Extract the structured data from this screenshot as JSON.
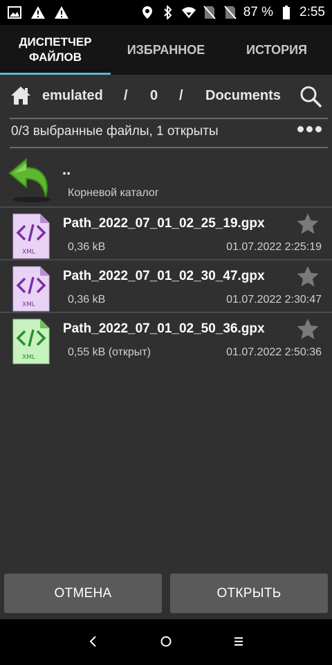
{
  "status_bar": {
    "battery_percent": "87 %",
    "time": "2:55",
    "icons_left": [
      "image-icon",
      "warning-icon",
      "warning-icon"
    ],
    "icons_right": [
      "location-icon",
      "bluetooth-icon",
      "wifi-icon",
      "no-sim-icon",
      "no-sim-icon"
    ]
  },
  "tabs": [
    {
      "label": "ДИСПЕТЧЕР ФАЙЛОВ",
      "active": true
    },
    {
      "label": "ИЗБРАННОЕ",
      "active": false
    },
    {
      "label": "ИСТОРИЯ",
      "active": false
    }
  ],
  "path": {
    "segments": [
      "emulated",
      "/",
      "0",
      "/",
      "Documents"
    ]
  },
  "selection_info": "0/3 выбранные файлы, 1 открыты",
  "parent_dir": {
    "name": "..",
    "subtitle": "Корневой каталог"
  },
  "files": [
    {
      "name": "Path_2022_07_01_02_25_19.gpx",
      "size": "0,36 kB",
      "date": "01.07.2022 2:25:19",
      "icon": "xml-file-icon",
      "color": "#8e44ad"
    },
    {
      "name": "Path_2022_07_01_02_30_47.gpx",
      "size": "0,36 kB",
      "date": "01.07.2022 2:30:47",
      "icon": "xml-file-icon",
      "color": "#8e44ad"
    },
    {
      "name": "Path_2022_07_01_02_50_36.gpx",
      "size": "0,55 kB (открыт)",
      "date": "01.07.2022 2:50:36",
      "icon": "xml-file-icon",
      "color": "#3ca33c"
    }
  ],
  "buttons": {
    "cancel": "ОТМЕНА",
    "open": "ОТКРЫТЬ"
  },
  "colors": {
    "tab_indicator": "#5fb8c9",
    "background": "#303030",
    "button": "#5a5a5a"
  }
}
